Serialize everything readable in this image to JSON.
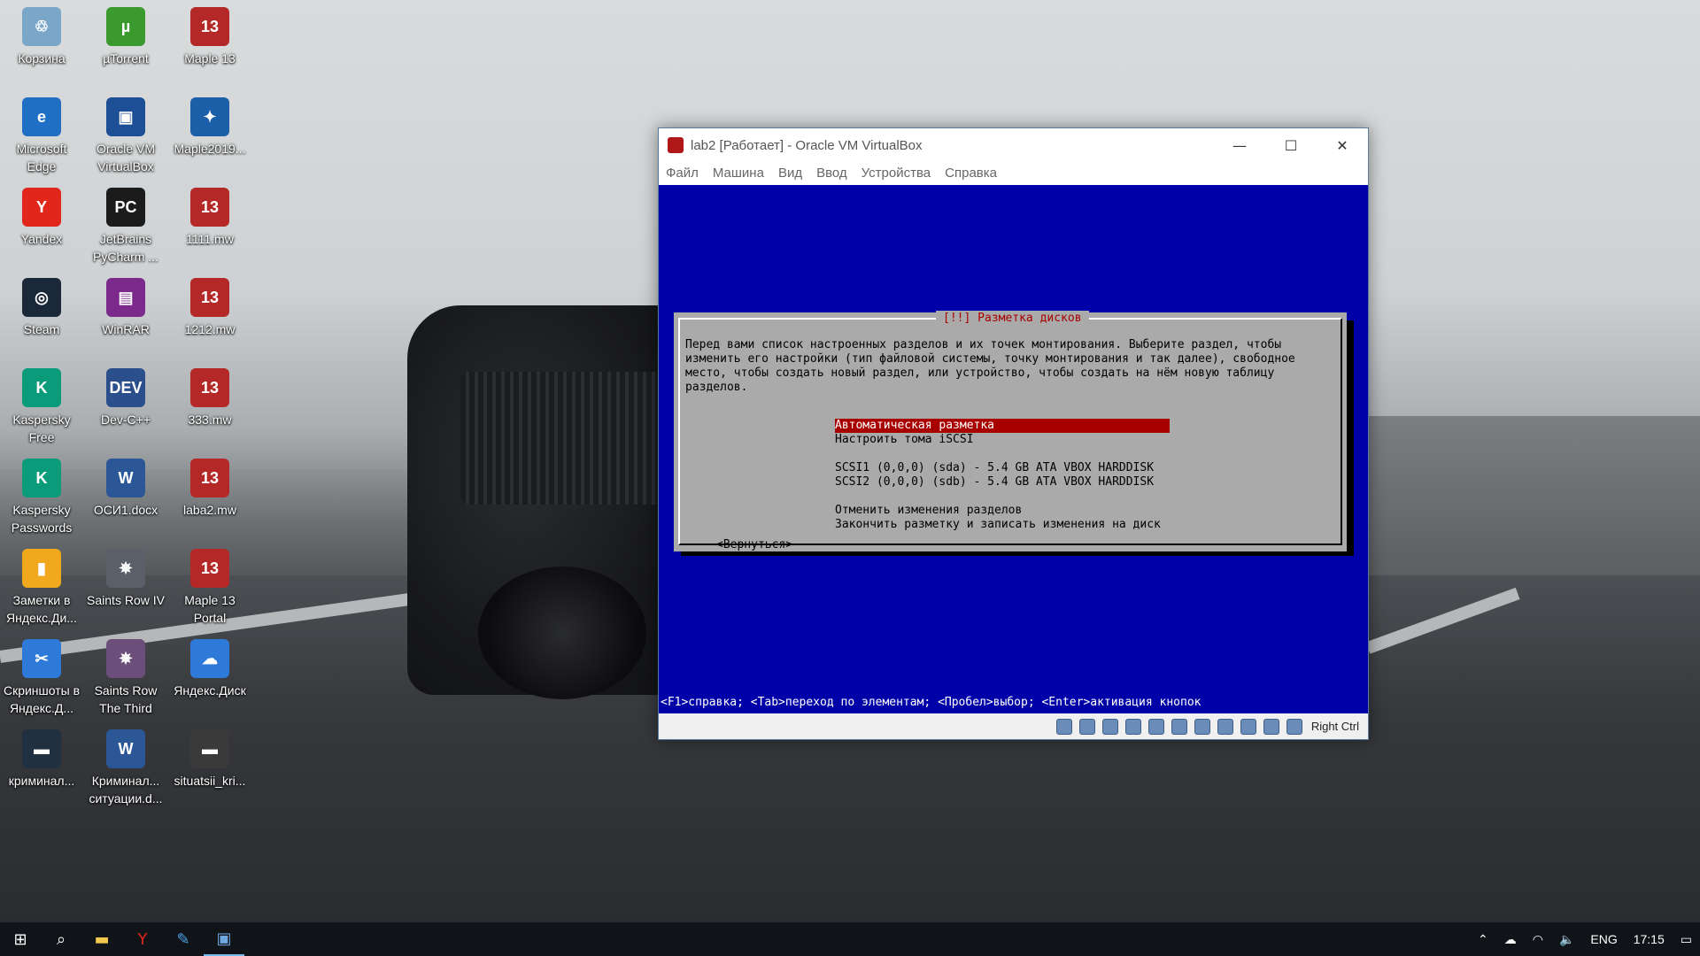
{
  "desktop": {
    "icons": [
      {
        "label": "Корзина",
        "glyph": "♲",
        "color": "#7aa6c8"
      },
      {
        "label": "µTorrent",
        "glyph": "µ",
        "color": "#3a9a2e"
      },
      {
        "label": "Maple 13",
        "glyph": "13",
        "color": "#b52828"
      },
      {
        "label": "Microsoft Edge",
        "glyph": "e",
        "color": "#1f6fc5"
      },
      {
        "label": "Oracle VM VirtualBox",
        "glyph": "▣",
        "color": "#1c4f96"
      },
      {
        "label": "Maple2019...",
        "glyph": "✦",
        "color": "#1a5fa8"
      },
      {
        "label": "Yandex",
        "glyph": "Y",
        "color": "#e1261c"
      },
      {
        "label": "JetBrains PyCharm ...",
        "glyph": "PC",
        "color": "#1b1b1b"
      },
      {
        "label": "1111.mw",
        "glyph": "13",
        "color": "#b52828"
      },
      {
        "label": "Steam",
        "glyph": "◎",
        "color": "#1b2838"
      },
      {
        "label": "WinRAR",
        "glyph": "▤",
        "color": "#7b2a8c"
      },
      {
        "label": "1212.mw",
        "glyph": "13",
        "color": "#b52828"
      },
      {
        "label": "Kaspersky Free",
        "glyph": "K",
        "color": "#0a9c7a"
      },
      {
        "label": "Dev-C++",
        "glyph": "DEV",
        "color": "#2a4f8a"
      },
      {
        "label": "333.mw",
        "glyph": "13",
        "color": "#b52828"
      },
      {
        "label": "Kaspersky Passwords",
        "glyph": "K",
        "color": "#0a9c7a"
      },
      {
        "label": "ОСИ1.docx",
        "glyph": "W",
        "color": "#2b5797"
      },
      {
        "label": "laba2.mw",
        "glyph": "13",
        "color": "#b52828"
      },
      {
        "label": "Заметки в Яндекс.Ди...",
        "glyph": "▮",
        "color": "#f2a81d"
      },
      {
        "label": "Saints Row IV",
        "glyph": "✵",
        "color": "#5a5f6a"
      },
      {
        "label": "Maple 13 Portal",
        "glyph": "13",
        "color": "#b52828"
      },
      {
        "label": "Скриншоты в Яндекс.Д...",
        "glyph": "✂",
        "color": "#2d7ad8"
      },
      {
        "label": "Saints Row The Third",
        "glyph": "✵",
        "color": "#6b4e7a"
      },
      {
        "label": "Яндекс.Диск",
        "glyph": "☁",
        "color": "#2d7ad8"
      },
      {
        "label": "криминал...",
        "glyph": "▬",
        "color": "#203040"
      },
      {
        "label": "Криминал... ситуации.d...",
        "glyph": "W",
        "color": "#2b5797"
      },
      {
        "label": "situatsii_kri...",
        "glyph": "▬",
        "color": "#3a3a3a"
      }
    ]
  },
  "vbox": {
    "title": "lab2 [Работает] - Oracle VM VirtualBox",
    "controls": {
      "minimize": "—",
      "maximize": "☐",
      "close": "✕"
    },
    "menu": [
      "Файл",
      "Машина",
      "Вид",
      "Ввод",
      "Устройства",
      "Справка"
    ],
    "host_key": "Right Ctrl",
    "installer": {
      "title": "[!!] Разметка дисков",
      "intro": "Перед вами список настроенных разделов и их точек монтирования. Выберите раздел, чтобы\nизменить его настройки (тип файловой системы, точку монтирования и так далее), свободное\nместо, чтобы создать новый раздел, или устройство, чтобы создать на нём новую таблицу\nразделов.",
      "options": [
        "Автоматическая разметка",
        "Настроить тома iSCSI",
        "SCSI1 (0,0,0) (sda) - 5.4 GB ATA VBOX HARDDISK",
        "SCSI2 (0,0,0) (sdb) - 5.4 GB ATA VBOX HARDDISK",
        "Отменить изменения разделов",
        "Закончить разметку и записать изменения на диск"
      ],
      "selected_index": 0,
      "go_back": "<Вернуться>",
      "help": "<F1>справка; <Tab>переход по элементам; <Пробел>выбор; <Enter>активация кнопок"
    }
  },
  "taskbar": {
    "language": "ENG",
    "time": "17:15"
  }
}
